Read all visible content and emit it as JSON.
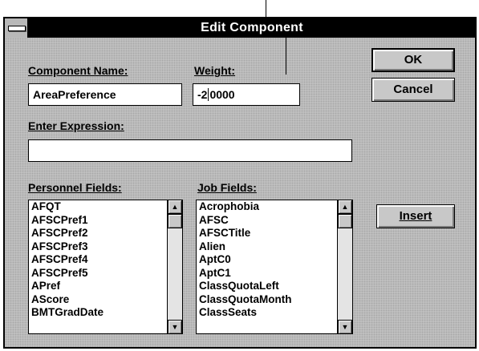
{
  "window": {
    "title": "Edit Component"
  },
  "component_name": {
    "label": "Component Name:",
    "value": "AreaPreference"
  },
  "weight": {
    "label": "Weight:",
    "value_before_caret": "-2",
    "value_after_caret": "0000"
  },
  "expression": {
    "label": "Enter Expression:",
    "value": ""
  },
  "buttons": {
    "ok": "OK",
    "cancel": "Cancel",
    "insert": "Insert"
  },
  "personnel_fields": {
    "label": "Personnel Fields:",
    "items": [
      "AFQT",
      "AFSCPref1",
      "AFSCPref2",
      "AFSCPref3",
      "AFSCPref4",
      "AFSCPref5",
      "APref",
      "AScore",
      "BMTGradDate"
    ]
  },
  "job_fields": {
    "label": "Job Fields:",
    "items": [
      "Acrophobia",
      "AFSC",
      "AFSCTitle",
      "Alien",
      "AptC0",
      "AptC1",
      "ClassQuotaLeft",
      "ClassQuotaMonth",
      "ClassSeats"
    ]
  },
  "icons": {
    "system_menu": "system-menu-icon",
    "scroll_up": "scroll-up-arrow-icon",
    "scroll_down": "scroll-down-arrow-icon"
  },
  "colors": {
    "titlebar": "#000000",
    "dialog": "#c4c4c4",
    "field": "#ffffff"
  }
}
